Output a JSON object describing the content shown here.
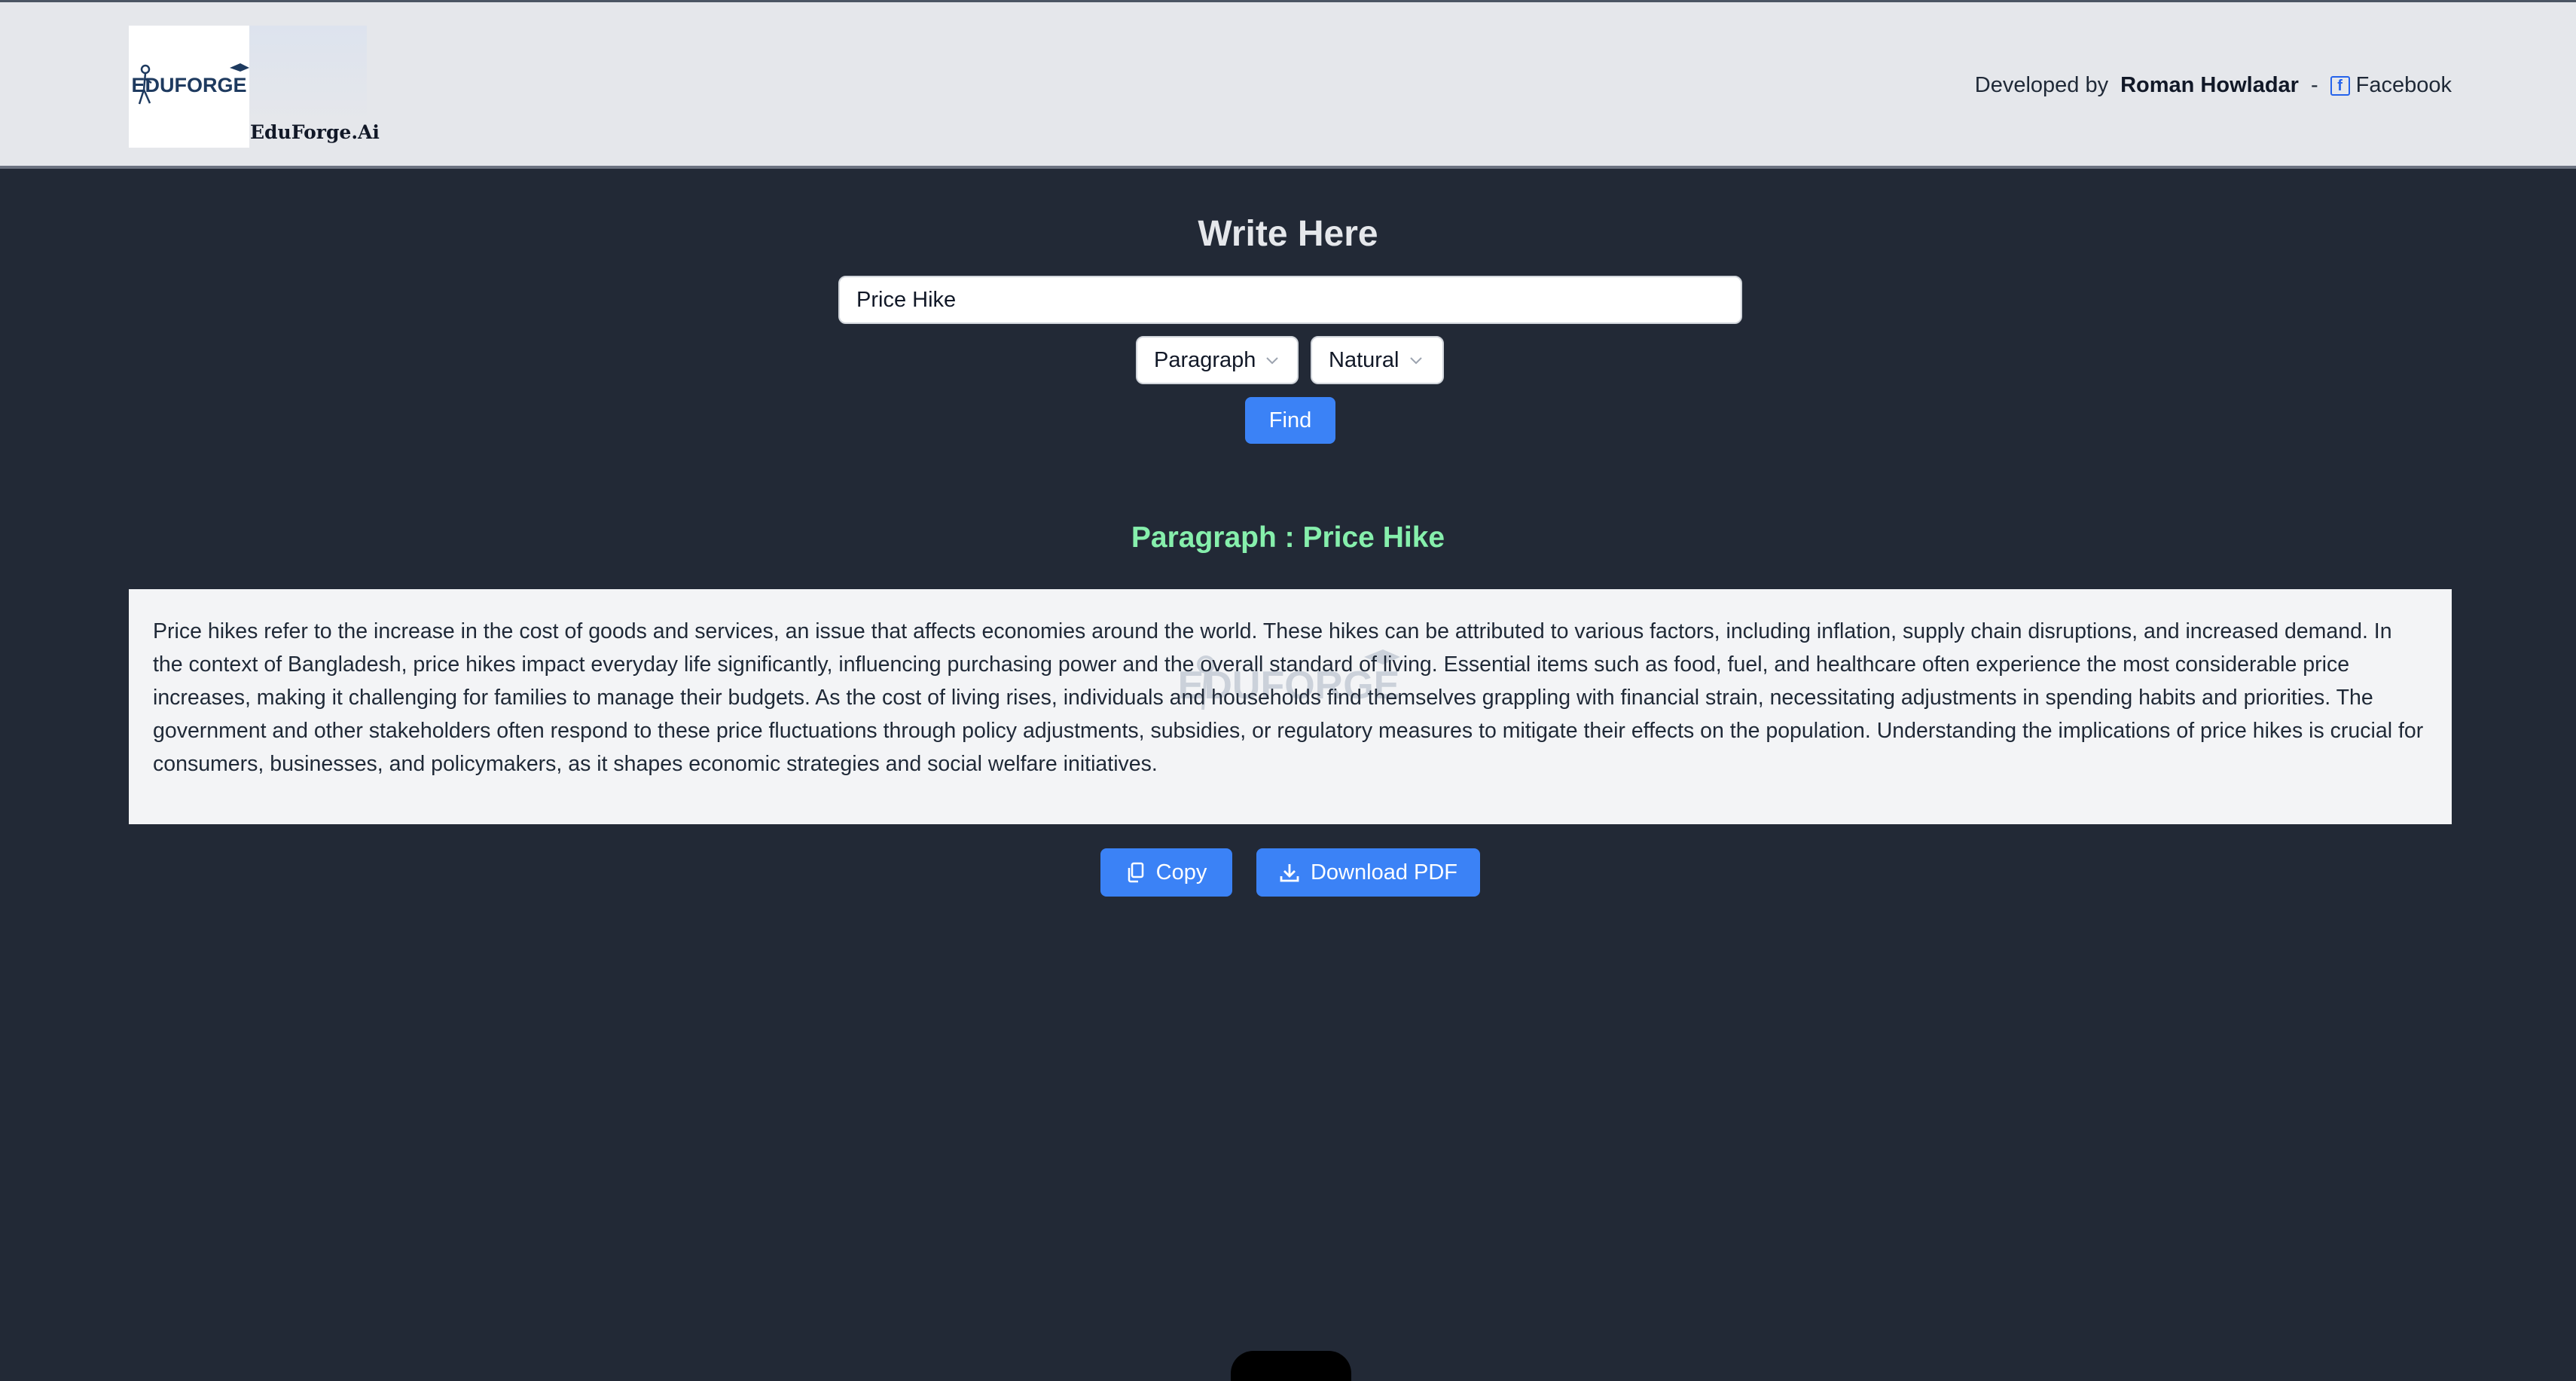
{
  "header": {
    "logo_text": "EDUFORGE",
    "brand_name": "EduForge.Ai",
    "developed_by_label": "Developed by",
    "author_name": "Roman Howladar",
    "separator": "-",
    "facebook_icon": "facebook-icon",
    "facebook_label": "Facebook"
  },
  "form": {
    "heading": "Write Here",
    "topic_value": "Price Hike",
    "type_select": {
      "selected": "Paragraph",
      "icon": "chevron-down-icon"
    },
    "tone_select": {
      "selected": "Natural",
      "icon": "chevron-down-icon"
    },
    "find_label": "Find"
  },
  "result": {
    "title": "Paragraph : Price Hike",
    "watermark_text": "EDUFORGE",
    "text": "Price hikes refer to the increase in the cost of goods and services, an issue that affects economies around the world. These hikes can be attributed to various factors, including inflation, supply chain disruptions, and increased demand. In the context of Bangladesh, price hikes impact everyday life significantly, influencing purchasing power and the overall standard of living. Essential items such as food, fuel, and healthcare often experience the most considerable price increases, making it challenging for families to manage their budgets. As the cost of living rises, individuals and households find themselves grappling with financial strain, necessitating adjustments in spending habits and priorities. The government and other stakeholders often respond to these price fluctuations through policy adjustments, subsidies, or regulatory measures to mitigate their effects on the population. Understanding the implications of price hikes is crucial for consumers, businesses, and policymakers, as it shapes economic strategies and social welfare initiatives."
  },
  "actions": {
    "copy_label": "Copy",
    "copy_icon": "copy-icon",
    "download_label": "Download PDF",
    "download_icon": "download-icon"
  },
  "colors": {
    "header_bg": "#e5e7eb",
    "page_bg": "#222936",
    "accent": "#3b82f6",
    "result_title": "#86efac",
    "result_bg": "#f3f4f6"
  }
}
